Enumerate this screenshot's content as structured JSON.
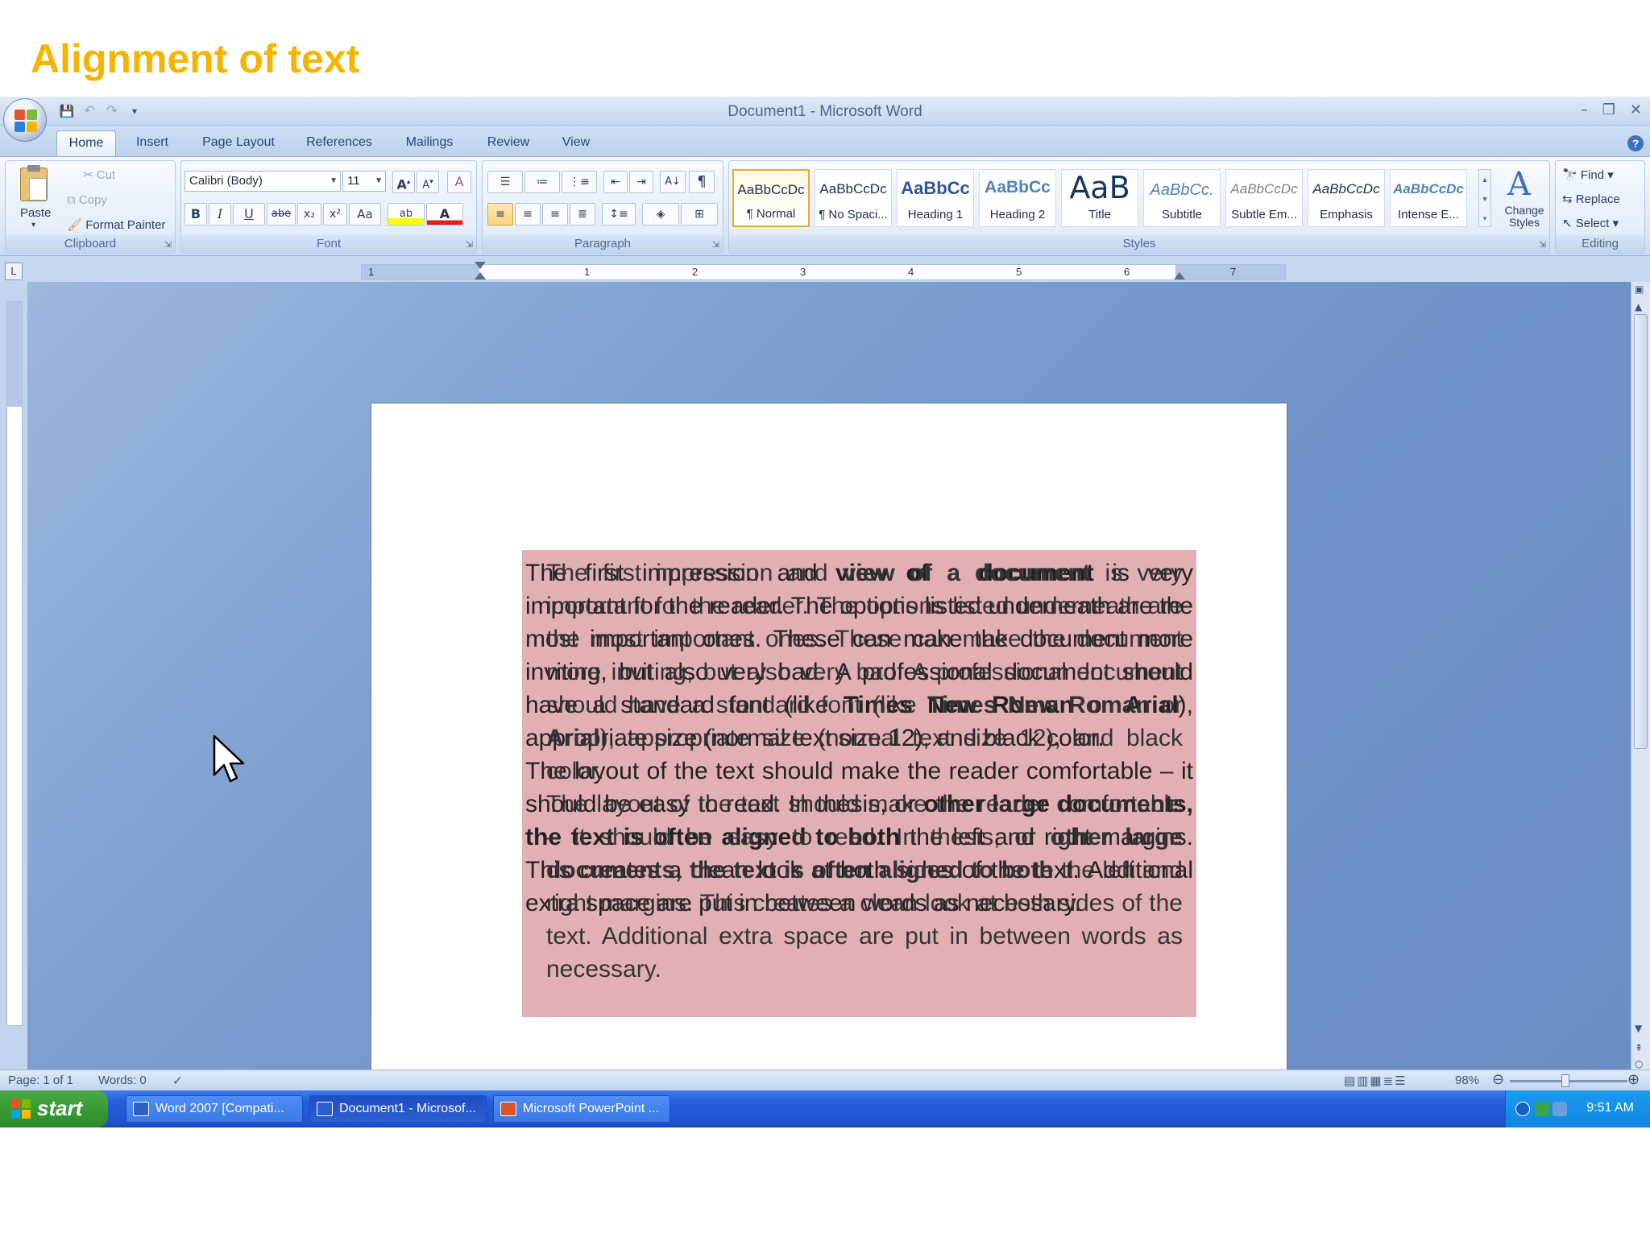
{
  "slide": {
    "title": "Alignment of text"
  },
  "window": {
    "title": "Document1 - Microsoft Word",
    "controls": {
      "minimize": "–",
      "restore": "❐",
      "close": "✕"
    }
  },
  "quick_access": {
    "save": "💾",
    "undo": "↶",
    "redo": "↷",
    "more": "▾"
  },
  "tabs": [
    {
      "label": "Home",
      "active": true
    },
    {
      "label": "Insert"
    },
    {
      "label": "Page Layout"
    },
    {
      "label": "References"
    },
    {
      "label": "Mailings"
    },
    {
      "label": "Review"
    },
    {
      "label": "View"
    }
  ],
  "help": "?",
  "clipboard": {
    "group_label": "Clipboard",
    "paste": "Paste",
    "cut": "Cut",
    "copy": "Copy",
    "format_painter": "Format Painter"
  },
  "font": {
    "group_label": "Font",
    "font_name": "Calibri (Body)",
    "font_size": "11",
    "grow": "A",
    "shrink": "A",
    "clear": "A",
    "bold": "B",
    "italic": "I",
    "underline": "U",
    "strike": "abe",
    "subscript": "x₂",
    "superscript": "x²",
    "change_case": "Aa",
    "highlight": "ab",
    "font_color": "A"
  },
  "paragraph": {
    "group_label": "Paragraph",
    "pilcrow": "¶",
    "sort": "A↓"
  },
  "styles": {
    "group_label": "Styles",
    "items": [
      {
        "sample": "AaBbCcDc",
        "name": "¶ Normal",
        "selected": true
      },
      {
        "sample": "AaBbCcDc",
        "name": "¶ No Spaci..."
      },
      {
        "sample": "AaBbCc",
        "name": "Heading 1"
      },
      {
        "sample": "AaBbCc",
        "name": "Heading 2"
      },
      {
        "sample": "AaB",
        "name": "Title"
      },
      {
        "sample": "AaBbCc.",
        "name": "Subtitle"
      },
      {
        "sample": "AaBbCcDc",
        "name": "Subtle Em..."
      },
      {
        "sample": "AaBbCcDc",
        "name": "Emphasis"
      },
      {
        "sample": "AaBbCcDc",
        "name": "Intense E..."
      }
    ],
    "change_styles": "Change Styles"
  },
  "editing": {
    "group_label": "Editing",
    "find": "Find",
    "replace": "Replace",
    "select": "Select"
  },
  "ruler": {
    "tab_selector": "L",
    "numbers": [
      "1",
      "1",
      "2",
      "3",
      "4",
      "5",
      "6",
      "7"
    ]
  },
  "document": {
    "paragraph1_parts": [
      "The first impression and ",
      "view of a document",
      " is very important for the reader. The options listed underneath are the most important ones. These can make the document more inviting, but also very bad. A professional document should have a standard font (like ",
      "Times New Roman",
      " or ",
      "Arial",
      "), appropriate size (normal text size 12), and black color."
    ],
    "paragraph2_parts": [
      "The layout of the text should make the reader comfortable – it should be easy to read. In thesis, or ",
      "other large documents, the text is often aligned to both",
      " the left and right margins. This creates a clean look at both sides of the text. Additional extra space are put in between words as necessary."
    ]
  },
  "statusbar": {
    "page": "Page: 1 of 1",
    "words": "Words: 0",
    "zoom": "98%",
    "zoom_out": "⊖",
    "zoom_in": "⊕"
  },
  "taskbar": {
    "start": "start",
    "items": [
      {
        "label": "Word 2007 [Compati..."
      },
      {
        "label": "Document1 - Microsof...",
        "active": true
      },
      {
        "label": "Microsoft PowerPoint ..."
      }
    ],
    "clock": "9:51 AM"
  },
  "colors": {
    "title": "#f5b400",
    "textbox": "#e2b0b4",
    "taskbar": "#245edb",
    "start": "#379b33"
  }
}
